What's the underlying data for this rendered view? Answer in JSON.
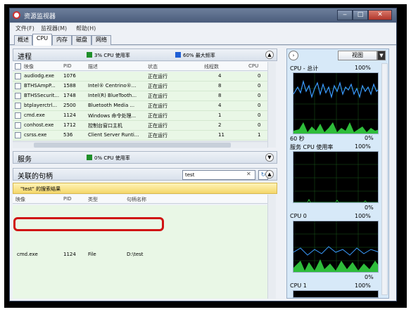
{
  "window": {
    "title": "资源监视器"
  },
  "menu": [
    "文件(F)",
    "监视器(M)",
    "帮助(H)"
  ],
  "tabs": [
    "概述",
    "CPU",
    "内存",
    "磁盘",
    "网络"
  ],
  "processes": {
    "title": "进程",
    "cpu_usage": "3% CPU 使用率",
    "max_freq": "60% 最大频率",
    "columns": [
      "映像",
      "PID",
      "描述",
      "状态",
      "线程数",
      "CPU"
    ],
    "rows": [
      {
        "image": "audiodg.exe",
        "pid": "1076",
        "desc": "",
        "status": "正在运行",
        "threads": "4",
        "cpu": "0"
      },
      {
        "image": "BTHSAmpP...",
        "pid": "1588",
        "desc": "Intel® Centrino®...",
        "status": "正在运行",
        "threads": "8",
        "cpu": "0"
      },
      {
        "image": "BTHSSecurit...",
        "pid": "1748",
        "desc": "Intel(R) BlueTooth...",
        "status": "正在运行",
        "threads": "8",
        "cpu": "0"
      },
      {
        "image": "btplayerctrl...",
        "pid": "2500",
        "desc": "Bluetooth Media ...",
        "status": "正在运行",
        "threads": "4",
        "cpu": "0"
      },
      {
        "image": "cmd.exe",
        "pid": "1124",
        "desc": "Windows 命令处理...",
        "status": "正在运行",
        "threads": "1",
        "cpu": "0"
      },
      {
        "image": "conhost.exe",
        "pid": "1712",
        "desc": "控制台窗口主机",
        "status": "正在运行",
        "threads": "2",
        "cpu": "0"
      },
      {
        "image": "csrss.exe",
        "pid": "536",
        "desc": "Client Server Runti...",
        "status": "正在运行",
        "threads": "11",
        "cpu": "1"
      }
    ]
  },
  "services": {
    "title": "服务",
    "cpu_usage": "0% CPU 使用率"
  },
  "handles": {
    "title": "关联的句柄",
    "search_value": "test",
    "result_banner": "\"test\" 的搜索结果",
    "columns": [
      "映像",
      "PID",
      "类型",
      "句柄名称"
    ],
    "rows": [
      {
        "image": "cmd.exe",
        "pid": "1124",
        "type": "File",
        "name": "D:\\test"
      }
    ]
  },
  "right_panel": {
    "view_label": "视图",
    "graphs": [
      {
        "title": "CPU - 总计",
        "max": "100%",
        "time": "60 秒",
        "min": "0%"
      },
      {
        "title": "服务 CPU 使用率",
        "max": "100%",
        "min": "0%"
      },
      {
        "title": "CPU 0",
        "max": "100%",
        "min": "0%"
      },
      {
        "title": "CPU 1",
        "max": "100%"
      }
    ]
  },
  "colors": {
    "process_swatch": "#1f8f2a",
    "freq_swatch": "#1f5fd6",
    "graph_line": "#3a9bff",
    "graph_fill": "#2ebd3a",
    "highlight": "#d01414"
  }
}
